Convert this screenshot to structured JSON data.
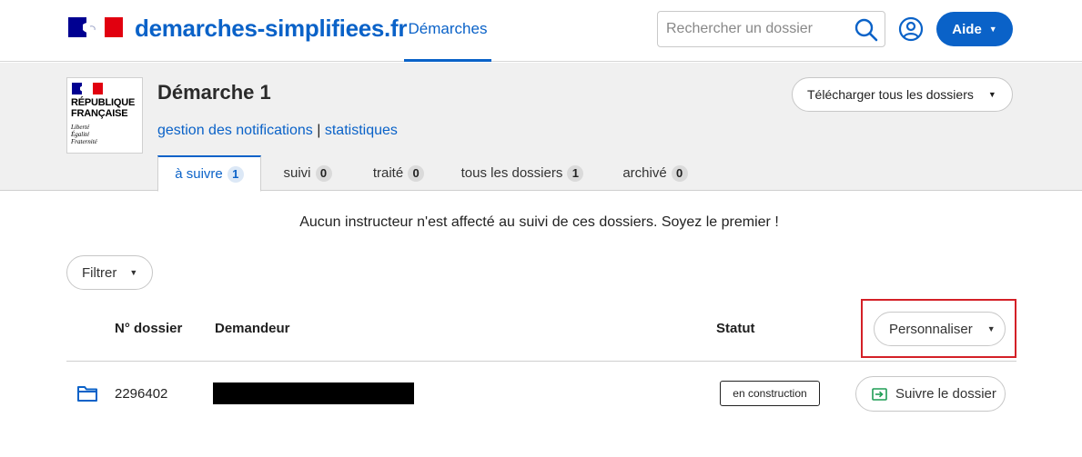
{
  "header": {
    "site_name": "demarches-simplifiees.fr",
    "nav_demarches": "Démarches",
    "search_placeholder": "Rechercher un dossier",
    "help_label": "Aide"
  },
  "procedure": {
    "logo_line1": "RÉPUBLIQUE",
    "logo_line2": "FRANÇAISE",
    "logo_motto1": "Liberté",
    "logo_motto2": "Égalité",
    "logo_motto3": "Fraternité",
    "title": "Démarche 1",
    "link_notifications": "gestion des notifications",
    "link_separator": "|",
    "link_stats": "statistiques",
    "download_label": "Télécharger tous les dossiers"
  },
  "tabs": [
    {
      "label": "à suivre",
      "count": "1"
    },
    {
      "label": "suivi",
      "count": "0"
    },
    {
      "label": "traité",
      "count": "0"
    },
    {
      "label": "tous les dossiers",
      "count": "1"
    },
    {
      "label": "archivé",
      "count": "0"
    }
  ],
  "content": {
    "notice": "Aucun instructeur n'est affecté au suivi de ces dossiers. Soyez le premier !",
    "filter_label": "Filtrer",
    "columns": {
      "dossier": "N° dossier",
      "demandeur": "Demandeur",
      "statut": "Statut"
    },
    "customize_label": "Personnaliser"
  },
  "rows": [
    {
      "dossier_number": "2296402",
      "status": "en construction",
      "action_label": "Suivre le dossier"
    }
  ],
  "colors": {
    "primary": "#0a62c8",
    "highlight": "#d42027",
    "band_bg": "#f0f0f0"
  },
  "icons": {
    "caret": "▼"
  }
}
